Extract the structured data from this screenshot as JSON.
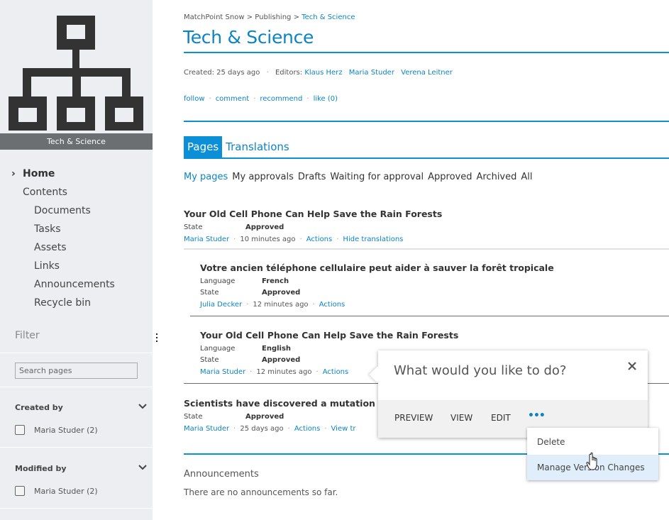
{
  "sidebar": {
    "site_label": "Tech & Science",
    "nav": [
      {
        "label": "Home",
        "level": 0,
        "active": true
      },
      {
        "label": "Contents",
        "level": 1
      },
      {
        "label": "Documents",
        "level": 2
      },
      {
        "label": "Tasks",
        "level": 2
      },
      {
        "label": "Assets",
        "level": 2
      },
      {
        "label": "Links",
        "level": 2
      },
      {
        "label": "Announcements",
        "level": 2
      },
      {
        "label": "Recycle bin",
        "level": 2
      }
    ],
    "filter_title": "Filter",
    "search_placeholder": "Search pages",
    "facets": [
      {
        "title": "Created by",
        "options": [
          {
            "label": "Maria Studer (2)",
            "checked": false
          }
        ]
      },
      {
        "title": "Modified by",
        "options": [
          {
            "label": "Maria Studer (2)",
            "checked": false
          }
        ]
      }
    ]
  },
  "breadcrumb": {
    "items": [
      "MatchPoint Snow",
      "Publishing"
    ],
    "separator": ">",
    "current": "Tech & Science"
  },
  "page_title": "Tech & Science",
  "meta": {
    "created": "Created: 25 days ago",
    "editors_label": "Editors:",
    "editors": [
      "Klaus Herz",
      "Maria Studer",
      "Verena Leitner"
    ]
  },
  "social": {
    "follow": "follow",
    "comment": "comment",
    "recommend": "recommend",
    "like": "like (0)"
  },
  "tabs": [
    {
      "label": "Pages",
      "active": true
    },
    {
      "label": "Translations",
      "active": false
    }
  ],
  "filters": [
    {
      "label": "My pages",
      "active": true
    },
    {
      "label": "My approvals"
    },
    {
      "label": "Drafts"
    },
    {
      "label": "Waiting for approval"
    },
    {
      "label": "Approved"
    },
    {
      "label": "Archived"
    },
    {
      "label": "All"
    }
  ],
  "items": [
    {
      "title": "Your Old Cell Phone Can Help Save the Rain Forests",
      "state_label": "State",
      "state": "Approved",
      "author": "Maria Studer",
      "time": "10 minutes ago",
      "actions": "Actions",
      "extra_link": "Hide translations"
    },
    {
      "title": "Votre ancien téléphone cellulaire peut aider à sauver la forêt tropicale",
      "language_label": "Language",
      "language": "French",
      "state_label": "State",
      "state": "Approved",
      "author": "Julia Decker",
      "time": "12 minutes ago",
      "actions": "Actions"
    },
    {
      "title": "Your Old Cell Phone Can Help Save the Rain Forests",
      "language_label": "Language",
      "language": "English",
      "state_label": "State",
      "state": "Approved",
      "author": "Maria Studer",
      "time": "12 minutes ago",
      "actions": "Actions"
    },
    {
      "title": "Scientists have discovered a mutation l",
      "state_label": "State",
      "state": "Approved",
      "author": "Maria Studer",
      "time": "25 days ago",
      "actions": "Actions",
      "extra_link": "View tr"
    }
  ],
  "popup": {
    "question": "What would you like to do?",
    "buttons": [
      "PREVIEW",
      "VIEW",
      "EDIT"
    ],
    "more": "•••"
  },
  "menu": {
    "items": [
      {
        "label": "Delete",
        "hover": false
      },
      {
        "label": "Manage Version Changes",
        "hover": true
      }
    ]
  },
  "announcements": {
    "title": "Announcements",
    "empty_text": "There are no announcements so far."
  },
  "colors": {
    "accent": "#0b8fd6",
    "link": "#0b84c6",
    "sidebar_bg": "#eceef2",
    "logo_label_bg": "#6b6f72",
    "menu_hover": "#dfeefa"
  }
}
